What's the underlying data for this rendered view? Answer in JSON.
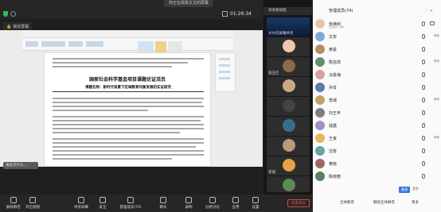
{
  "topbar": {
    "share_pill": "你正在观看文文的屏幕",
    "timer": "01:26:34"
  },
  "share_tag": "锁定屏幕",
  "document": {
    "title": "国家社会科学基金项目课题论证活页",
    "subtitle": "课题名称：新时代背景下区域教育均衡发展的实证研究"
  },
  "input_hint": "请说点什么...",
  "video_column": {
    "header": "演讲者视图",
    "tiles": [
      {
        "name": "文文的屏幕共享",
        "kind": "screen"
      },
      {
        "name": "",
        "kind": "avatar"
      },
      {
        "name": "张玉红",
        "kind": "person"
      },
      {
        "name": "",
        "kind": "photo"
      },
      {
        "name": "",
        "kind": "dark"
      },
      {
        "name": "",
        "kind": "photo"
      },
      {
        "name": "",
        "kind": "photo"
      },
      {
        "name": "",
        "kind": "planet"
      },
      {
        "name": "",
        "kind": "anime"
      },
      {
        "name": "李城",
        "kind": "person"
      },
      {
        "name": "",
        "kind": "nature"
      }
    ]
  },
  "participants": {
    "header": "管理成员(74)",
    "rows": [
      {
        "name": "张续树",
        "sub": "(主持人, 我)",
        "tag": ""
      },
      {
        "name": "文安",
        "sub": "",
        "tag": "静音"
      },
      {
        "name": "黄豪",
        "sub": "",
        "tag": ""
      },
      {
        "name": "陈信祥",
        "sub": "",
        "tag": "静音"
      },
      {
        "name": "马俊海",
        "sub": "",
        "tag": ""
      },
      {
        "name": "孙甘",
        "sub": "",
        "tag": ""
      },
      {
        "name": "李城",
        "sub": "",
        "tag": "静音"
      },
      {
        "name": "刘王丰",
        "sub": "",
        "tag": ""
      },
      {
        "name": "钱露",
        "sub": "",
        "tag": ""
      },
      {
        "name": "王良",
        "sub": "",
        "tag": "静音"
      },
      {
        "name": "沈俊",
        "sub": "",
        "tag": ""
      },
      {
        "name": "黄晓",
        "sub": "",
        "tag": ""
      },
      {
        "name": "陈晓丽",
        "sub": "",
        "tag": ""
      }
    ],
    "buttons": {
      "invite": "邀请",
      "mute_all": "全体静音",
      "unmute_all": "解除全体静音",
      "more": "更多"
    }
  },
  "bottombar": {
    "items": [
      {
        "label": "解除静音"
      },
      {
        "label": "开启视频"
      },
      {
        "label": "共享屏幕"
      },
      {
        "label": "安全"
      },
      {
        "label": "管理成员(74)"
      },
      {
        "label": "聊天"
      },
      {
        "label": "录制"
      },
      {
        "label": "分组讨论"
      },
      {
        "label": "应用"
      },
      {
        "label": "设置"
      }
    ],
    "leave": "结束会议",
    "mute_all": "全体静音",
    "unmute_all": "解除全体静音",
    "more": "更多"
  },
  "colors": {
    "accent": "#3b75d6",
    "danger": "#e45555",
    "secure": "#2fbf5a"
  }
}
